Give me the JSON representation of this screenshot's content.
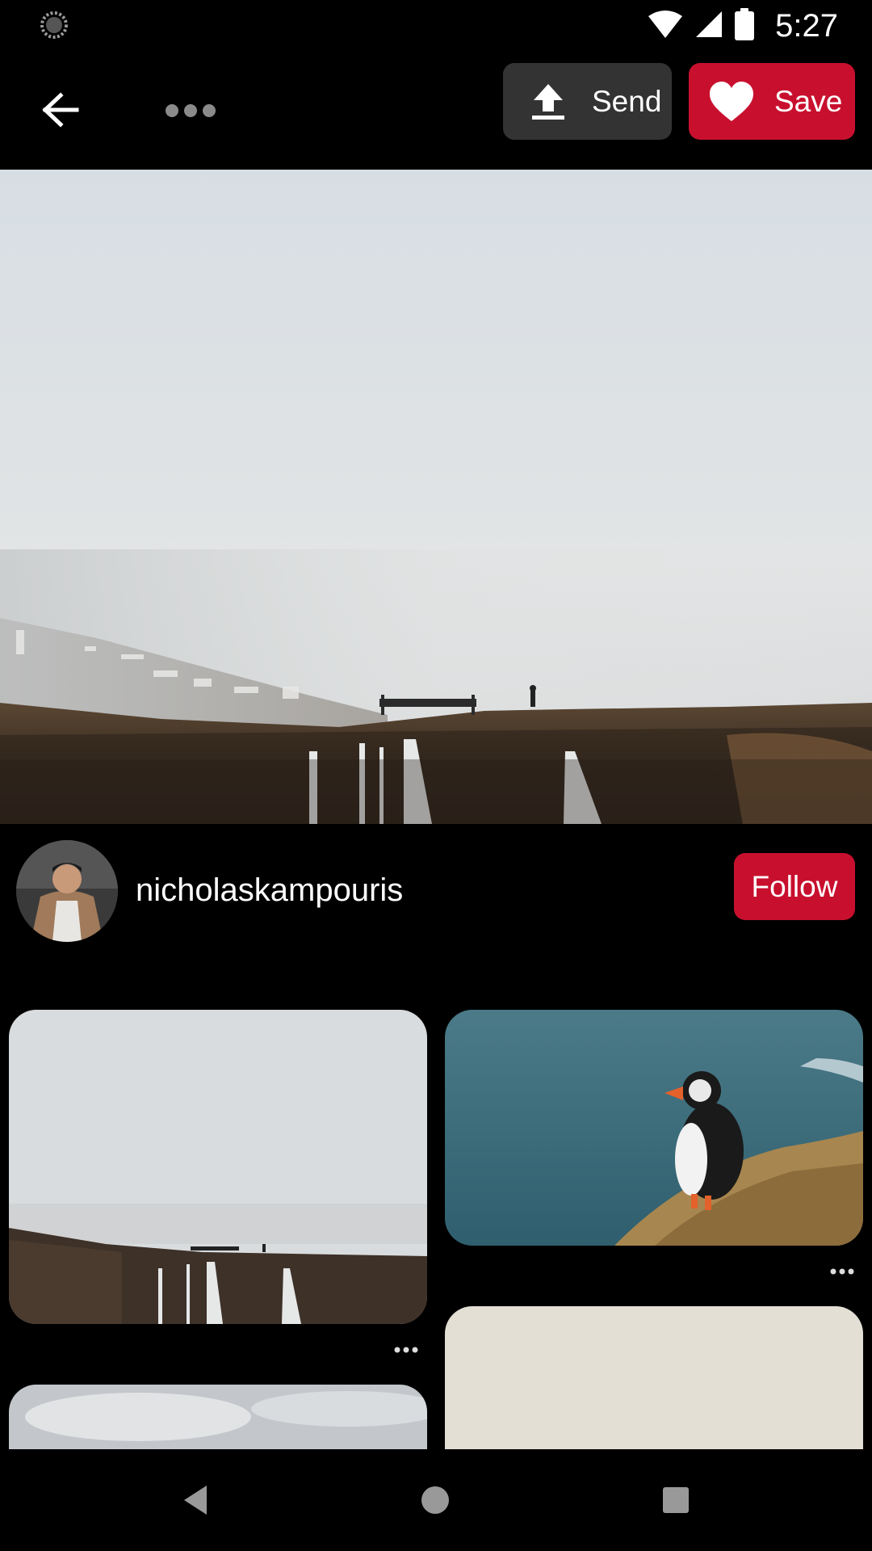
{
  "status_bar": {
    "time": "5:27",
    "icons": [
      "loading-spinner-icon",
      "wifi-icon",
      "cellular-signal-icon",
      "battery-icon"
    ]
  },
  "toolbar": {
    "back_icon": "arrow-left-icon",
    "more_icon": "more-dots-icon",
    "send_label": "Send",
    "send_icon": "upload-icon",
    "save_label": "Save",
    "save_icon": "heart-icon"
  },
  "author": {
    "name": "nicholaskampouris",
    "follow_label": "Follow"
  },
  "colors": {
    "brand_red": "#c8102e",
    "send_gray": "#333333",
    "background": "#000000"
  },
  "grid": {
    "cards": [
      {
        "subject": "foggy cliffs with waterfall",
        "has_more_menu": true
      },
      {
        "subject": "puffin on cliff over sea",
        "has_more_menu": true
      },
      {
        "subject": "cloudy sky",
        "has_more_menu": false
      },
      {
        "subject": "beige",
        "has_more_menu": false
      }
    ]
  },
  "nav_bar": {
    "icons": [
      "nav-back-icon",
      "nav-home-icon",
      "nav-recents-icon"
    ]
  }
}
